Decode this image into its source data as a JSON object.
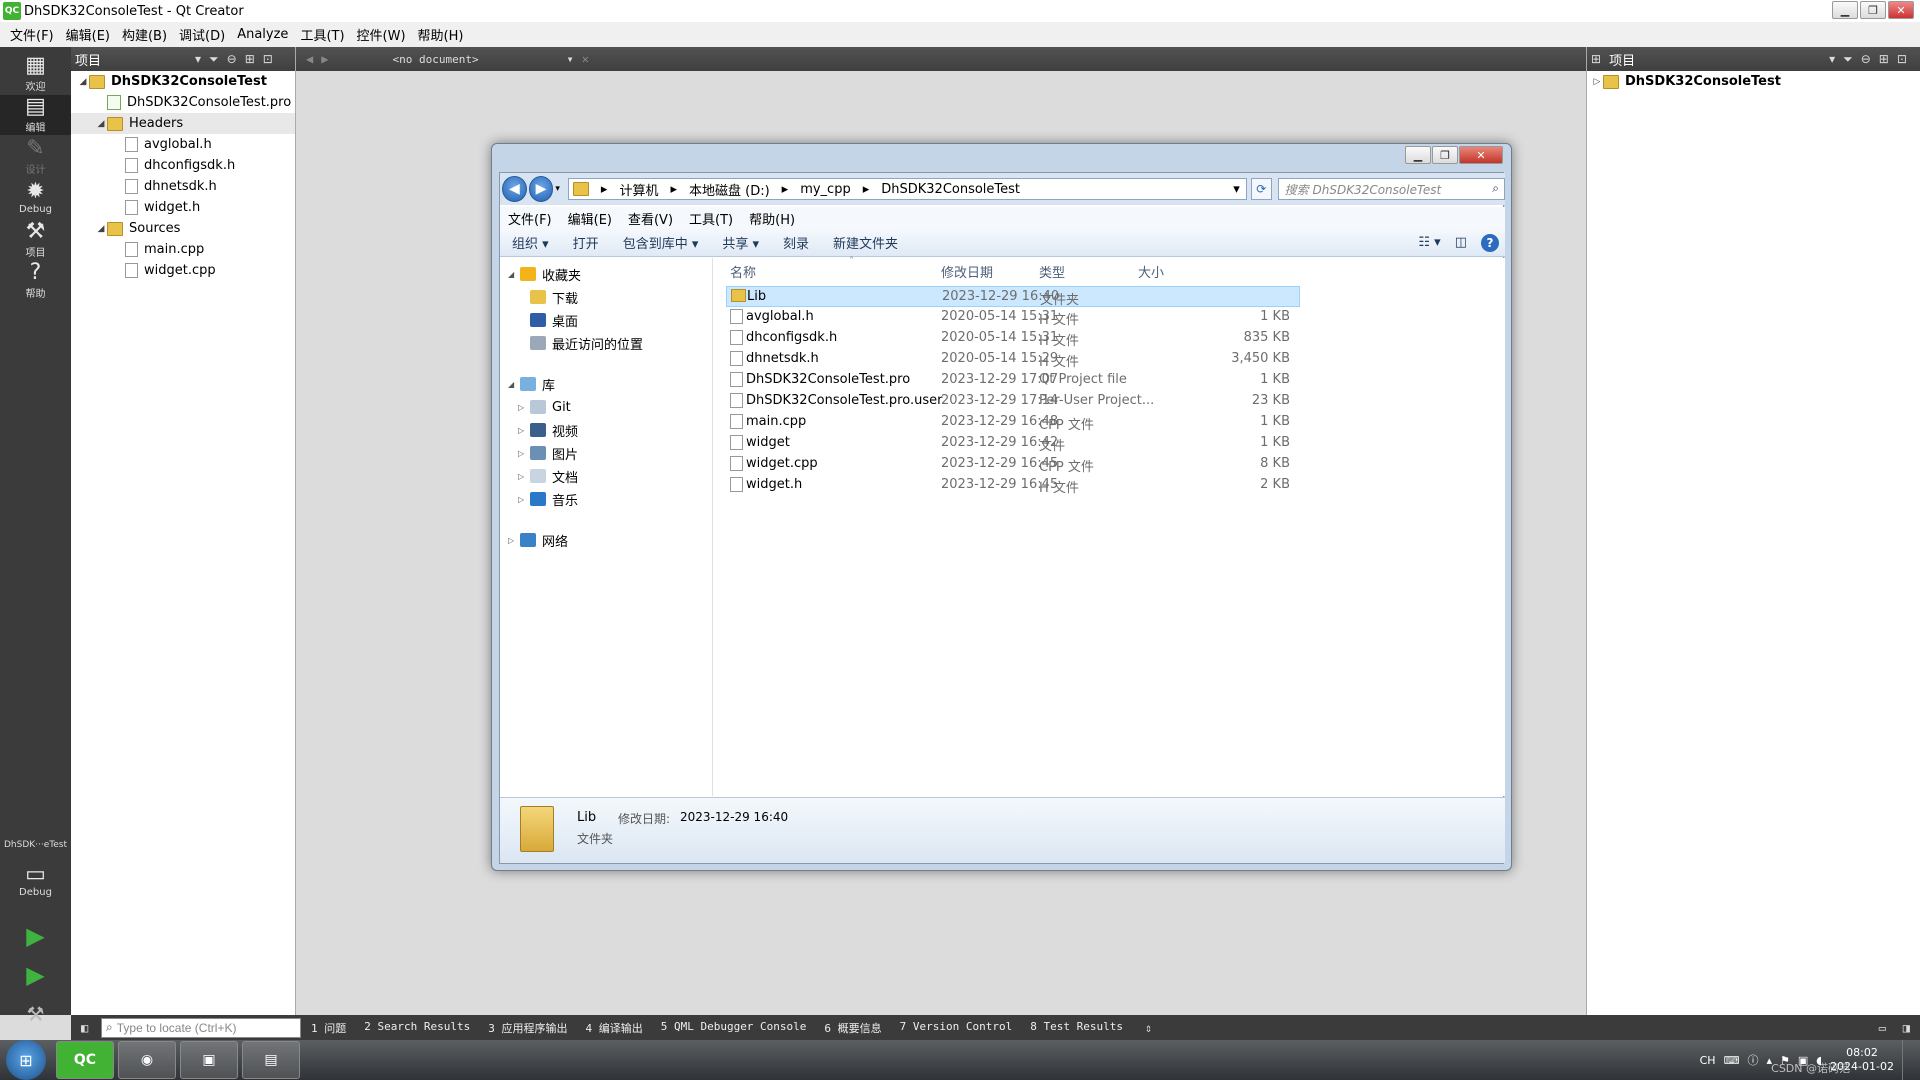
{
  "window": {
    "title": "DhSDK32ConsoleTest - Qt Creator",
    "app_badge": "QC"
  },
  "menu": [
    "文件(F)",
    "编辑(E)",
    "构建(B)",
    "调试(D)",
    "Analyze",
    "工具(T)",
    "控件(W)",
    "帮助(H)"
  ],
  "modes": [
    {
      "label": "欢迎",
      "icon": "▦",
      "active": false,
      "disabled": false
    },
    {
      "label": "编辑",
      "icon": "▤",
      "active": true,
      "disabled": false
    },
    {
      "label": "设计",
      "icon": "✎",
      "active": false,
      "disabled": true
    },
    {
      "label": "Debug",
      "icon": "✹",
      "active": false,
      "disabled": false
    },
    {
      "label": "项目",
      "icon": "⚒",
      "active": false,
      "disabled": false
    },
    {
      "label": "帮助",
      "icon": "?",
      "active": false,
      "disabled": false
    }
  ],
  "kit": {
    "project": "DhSDK···eTest",
    "config": "Debug"
  },
  "left_pane": {
    "header": "项目",
    "tree": [
      {
        "label": "DhSDK32ConsoleTest",
        "level": 0,
        "type": "project",
        "expanded": true,
        "bold": true
      },
      {
        "label": "DhSDK32ConsoleTest.pro",
        "level": 1,
        "type": "pro"
      },
      {
        "label": "Headers",
        "level": 1,
        "type": "folder",
        "expanded": true,
        "selected": true
      },
      {
        "label": "avglobal.h",
        "level": 2,
        "type": "file"
      },
      {
        "label": "dhconfigsdk.h",
        "level": 2,
        "type": "file"
      },
      {
        "label": "dhnetsdk.h",
        "level": 2,
        "type": "file"
      },
      {
        "label": "widget.h",
        "level": 2,
        "type": "file"
      },
      {
        "label": "Sources",
        "level": 1,
        "type": "folder",
        "expanded": true
      },
      {
        "label": "main.cpp",
        "level": 2,
        "type": "file"
      },
      {
        "label": "widget.cpp",
        "level": 2,
        "type": "file"
      }
    ]
  },
  "editor": {
    "document": "<no document>"
  },
  "right_pane": {
    "header": "项目",
    "tree_root": "DhSDK32ConsoleTest"
  },
  "output_bar": {
    "locate_placeholder": "Type to locate (Ctrl+K)",
    "tabs": [
      "1 问题",
      "2 Search Results",
      "3 应用程序输出",
      "4 编译输出",
      "5 QML Debugger Console",
      "6 概要信息",
      "7 Version Control",
      "8 Test Results"
    ]
  },
  "explorer": {
    "breadcrumb": [
      "计算机",
      "本地磁盘 (D:)",
      "my_cpp",
      "DhSDK32ConsoleTest"
    ],
    "search_placeholder": "搜索 DhSDK32ConsoleTest",
    "menu": [
      "文件(F)",
      "编辑(E)",
      "查看(V)",
      "工具(T)",
      "帮助(H)"
    ],
    "toolbar": [
      "组织 ▾",
      "打开",
      "包含到库中 ▾",
      "共享 ▾",
      "刻录",
      "新建文件夹"
    ],
    "nav": [
      {
        "label": "收藏夹",
        "level": 0,
        "icon_color": "#f2b418",
        "expander": "◢"
      },
      {
        "label": "下载",
        "level": 1,
        "icon_color": "#e9c24a"
      },
      {
        "label": "桌面",
        "level": 1,
        "icon_color": "#2f5ea8"
      },
      {
        "label": "最近访问的位置",
        "level": 1,
        "icon_color": "#9aa8b8"
      },
      {
        "label": "库",
        "level": 0,
        "icon_color": "#7ab0e0",
        "expander": "◢",
        "gap": true
      },
      {
        "label": "Git",
        "level": 1,
        "icon_color": "#b8c8d8",
        "expander": "▷"
      },
      {
        "label": "视频",
        "level": 1,
        "icon_color": "#3a5f8a",
        "expander": "▷"
      },
      {
        "label": "图片",
        "level": 1,
        "icon_color": "#6c8fb5",
        "expander": "▷"
      },
      {
        "label": "文档",
        "level": 1,
        "icon_color": "#c8d4e2",
        "expander": "▷"
      },
      {
        "label": "音乐",
        "level": 1,
        "icon_color": "#2a78c8",
        "expander": "▷"
      },
      {
        "label": "网络",
        "level": 0,
        "icon_color": "#3a82c8",
        "expander": "▷",
        "gap": true
      }
    ],
    "columns": [
      "名称",
      "修改日期",
      "类型",
      "大小"
    ],
    "files": [
      {
        "name": "Lib",
        "date": "2023-12-29 16:40",
        "type": "文件夹",
        "size": "",
        "dir": true,
        "selected": true
      },
      {
        "name": "avglobal.h",
        "date": "2020-05-14 15:31",
        "type": "H 文件",
        "size": "1 KB"
      },
      {
        "name": "dhconfigsdk.h",
        "date": "2020-05-14 15:31",
        "type": "H 文件",
        "size": "835 KB"
      },
      {
        "name": "dhnetsdk.h",
        "date": "2020-05-14 15:29",
        "type": "H 文件",
        "size": "3,450 KB"
      },
      {
        "name": "DhSDK32ConsoleTest.pro",
        "date": "2023-12-29 17:07",
        "type": "Qt Project file",
        "size": "1 KB"
      },
      {
        "name": "DhSDK32ConsoleTest.pro.user",
        "date": "2023-12-29 17:14",
        "type": "Per-User Project...",
        "size": "23 KB"
      },
      {
        "name": "main.cpp",
        "date": "2023-12-29 16:48",
        "type": "CPP 文件",
        "size": "1 KB"
      },
      {
        "name": "widget",
        "date": "2023-12-29 16:42",
        "type": "文件",
        "size": "1 KB"
      },
      {
        "name": "widget.cpp",
        "date": "2023-12-29 16:45",
        "type": "CPP 文件",
        "size": "8 KB"
      },
      {
        "name": "widget.h",
        "date": "2023-12-29 16:45",
        "type": "H 文件",
        "size": "2 KB"
      }
    ],
    "details": {
      "name": "Lib",
      "date_label": "修改日期:",
      "date": "2023-12-29 16:40",
      "type": "文件夹"
    }
  },
  "taskbar": {
    "apps": [
      "QC",
      "◉",
      "▣",
      "▤"
    ],
    "tray": {
      "lang": "CH",
      "time": "08:02",
      "date": "2024-01-02",
      "watermark": "CSDN @诺码范"
    }
  }
}
